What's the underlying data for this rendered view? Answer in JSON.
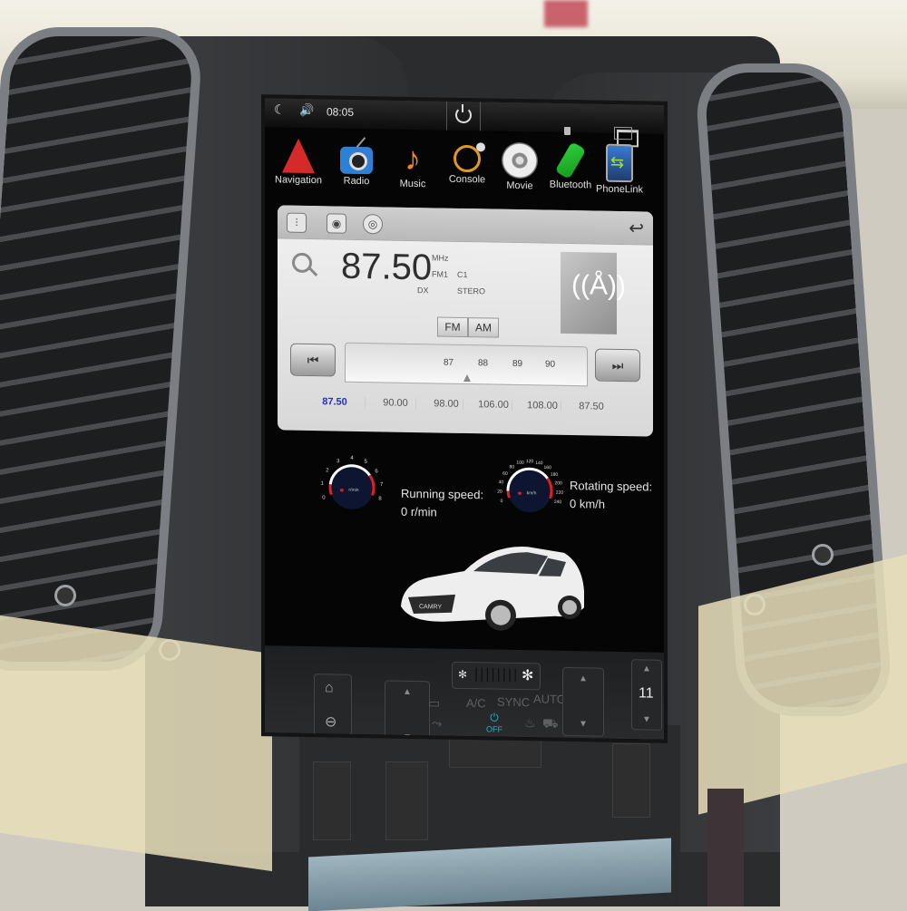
{
  "statusbar": {
    "time": "08:05",
    "icons": [
      "moon-icon",
      "volume-icon",
      "power-icon",
      "usb-icon",
      "windows-icon"
    ]
  },
  "apps": [
    {
      "label": "Navigation",
      "icon": "navigation-icon"
    },
    {
      "label": "Radio",
      "icon": "radio-icon"
    },
    {
      "label": "Music",
      "icon": "music-icon"
    },
    {
      "label": "Console",
      "icon": "console-icon"
    },
    {
      "label": "Movie",
      "icon": "movie-icon"
    },
    {
      "label": "Bluetooth",
      "icon": "bluetooth-icon"
    },
    {
      "label": "PhoneLink",
      "icon": "phonelink-icon"
    }
  ],
  "radio": {
    "toolbar_icons": [
      "equalizer-icon",
      "speaker-icon",
      "disc-icon",
      "back-icon"
    ],
    "frequency": "87.50",
    "unit": "MHz",
    "band": "FM1",
    "channel": "C1",
    "dx": "DX",
    "stereo": "STERO",
    "band_buttons": [
      "FM",
      "AM"
    ],
    "seek_prev": "⏮",
    "seek_next": "⏭",
    "dial_ticks": [
      "87",
      "88",
      "89",
      "90"
    ],
    "presets": [
      "87.50",
      "90.00",
      "98.00",
      "106.00",
      "108.00",
      "87.50"
    ],
    "active_preset": 0,
    "accent_color": "#2030c8"
  },
  "gauges": {
    "rpm": {
      "unit": "r/min",
      "ticks": [
        "0",
        "1",
        "2",
        "3",
        "4",
        "5",
        "6",
        "7",
        "8"
      ],
      "label": "Running speed:",
      "value_text": "0 r/min",
      "value": 0
    },
    "speed": {
      "unit": "km/h",
      "ticks": [
        "0",
        "20",
        "40",
        "60",
        "80",
        "100",
        "120",
        "140",
        "160",
        "180",
        "200",
        "220",
        "240"
      ],
      "label": "Rotating speed:",
      "value_text": "0 km/h",
      "value": 0
    }
  },
  "car": {
    "badge": "CAMRY"
  },
  "climate": {
    "ac": "A/C",
    "sync": "SYNC",
    "auto": "AUTO",
    "power_state": "OFF",
    "temperature": "11",
    "power_color": "#19b6d4"
  }
}
